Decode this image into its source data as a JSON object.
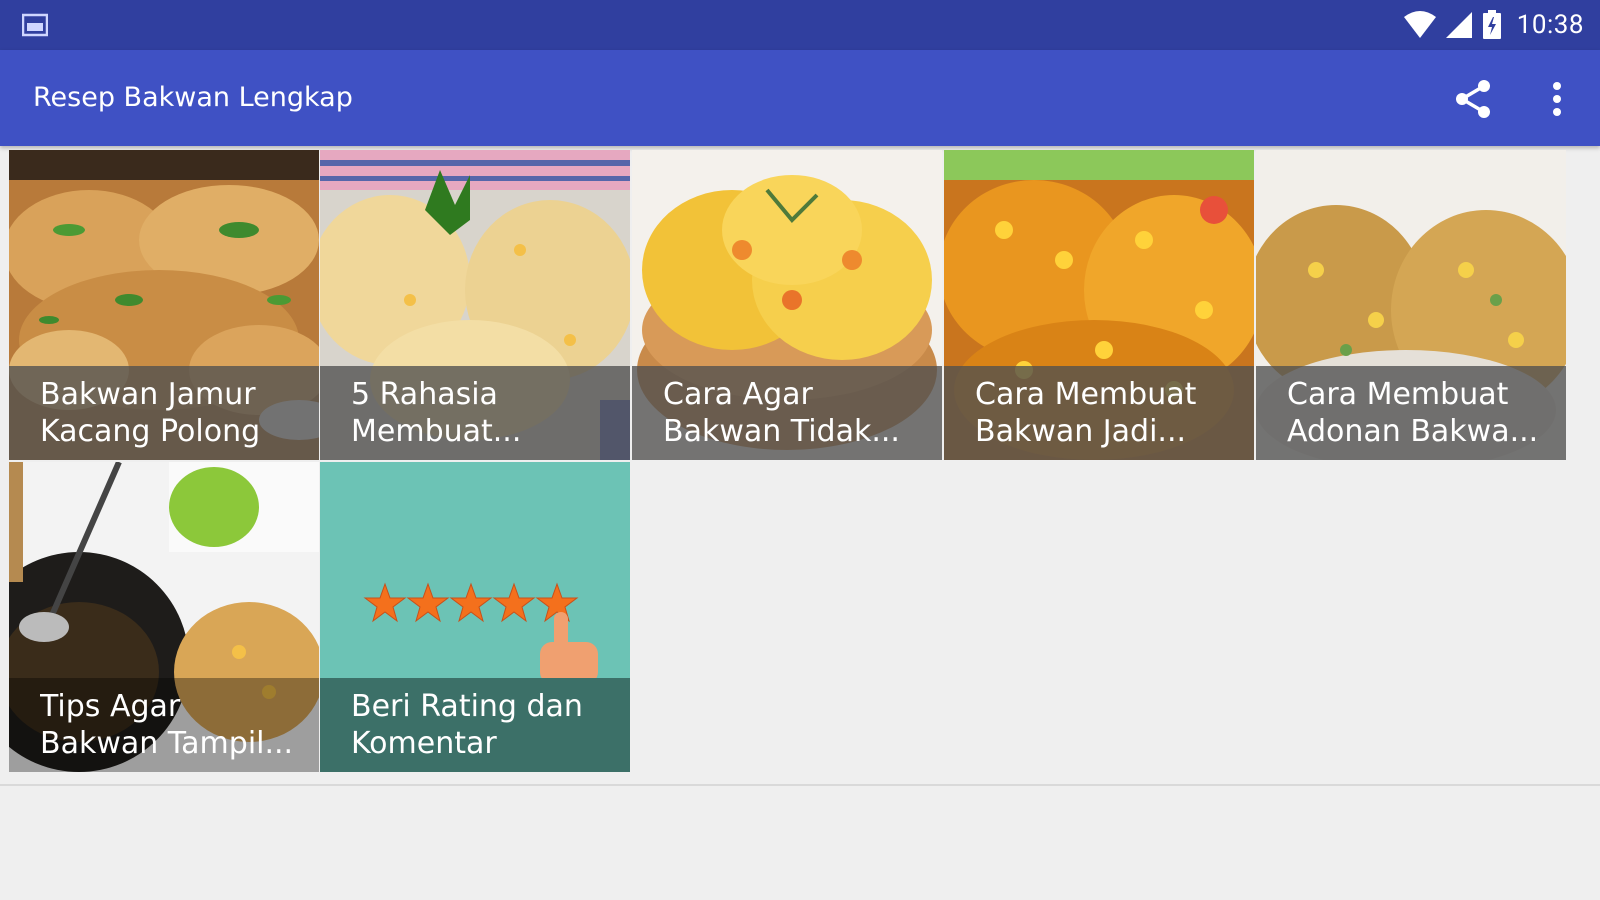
{
  "status_bar": {
    "time": "10:38",
    "left_icon": "image-notification-icon",
    "icons": [
      "wifi-icon",
      "cell-signal-icon",
      "battery-icon"
    ]
  },
  "app_bar": {
    "title": "Resep Bakwan Lengkap",
    "actions": [
      "share-icon",
      "more-vert-icon"
    ]
  },
  "tiles": [
    {
      "line1": "Bakwan Jamur",
      "line2": "Kacang Polong"
    },
    {
      "line1": "5 Rahasia",
      "line2": "Membuat..."
    },
    {
      "line1": "Cara Agar",
      "line2": "Bakwan Tidak..."
    },
    {
      "line1": "Cara Membuat",
      "line2": "Bakwan Jadi..."
    },
    {
      "line1": "Cara Membuat",
      "line2": "Adonan Bakwa..."
    },
    {
      "line1": "Tips Agar",
      "line2": "Bakwan Tampil..."
    },
    {
      "line1": "Beri Rating dan",
      "line2": "Komentar",
      "rating_stars": 5
    }
  ],
  "colors": {
    "status_bar": "#303f9f",
    "app_bar": "#3f51c4",
    "rating_tile": "#6cc3b5",
    "star": "#f4701c"
  }
}
